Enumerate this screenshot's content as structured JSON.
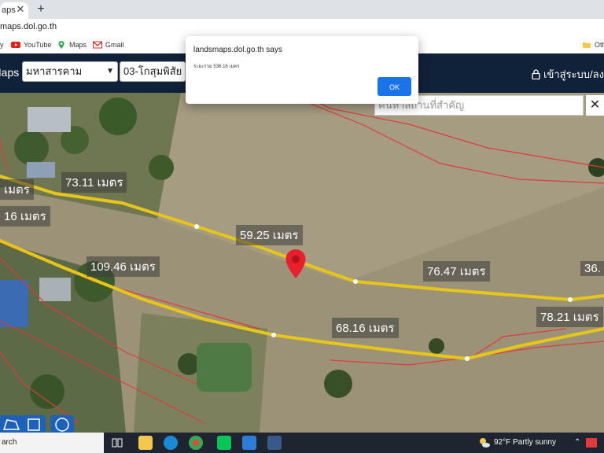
{
  "browser": {
    "tab_title": "aps",
    "url": "maps.dol.go.th",
    "bookmarks": [
      {
        "label": "YouTube",
        "icon": "youtube-icon"
      },
      {
        "label": "Maps",
        "icon": "maps-icon"
      },
      {
        "label": "Gmail",
        "icon": "gmail-icon"
      },
      {
        "label": "Oth",
        "icon": "folder-icon"
      }
    ]
  },
  "site": {
    "title": "Maps",
    "province_select": "มหาสารคาม",
    "district_select": "03-โกสุมพิสัย",
    "login_label": "เข้าสู่ระบบ/ลงท"
  },
  "map": {
    "search_placeholder": "ค้นหาสถานที่สำคัญ",
    "measurements": [
      "73.11 เมตร",
      "เมตร",
      "16 เมตร",
      "59.25 เมตร",
      "109.46 เมตร",
      "76.47 เมตร",
      "36.",
      "68.16 เมตร",
      "78.21 เมตร"
    ]
  },
  "dialog": {
    "title": "landsmaps.dol.go.th says",
    "message": "ระยะรวม 536.16 เมตร",
    "ok_label": "OK"
  },
  "taskbar": {
    "search_label": "arch",
    "weather": "92°F  Partly sunny"
  },
  "colors": {
    "accent": "#1a73e8",
    "nav_bg": "#10223a",
    "parcel_line": "#e6c619",
    "boundary_line": "#e03a3a",
    "pin": "#e8202e"
  }
}
